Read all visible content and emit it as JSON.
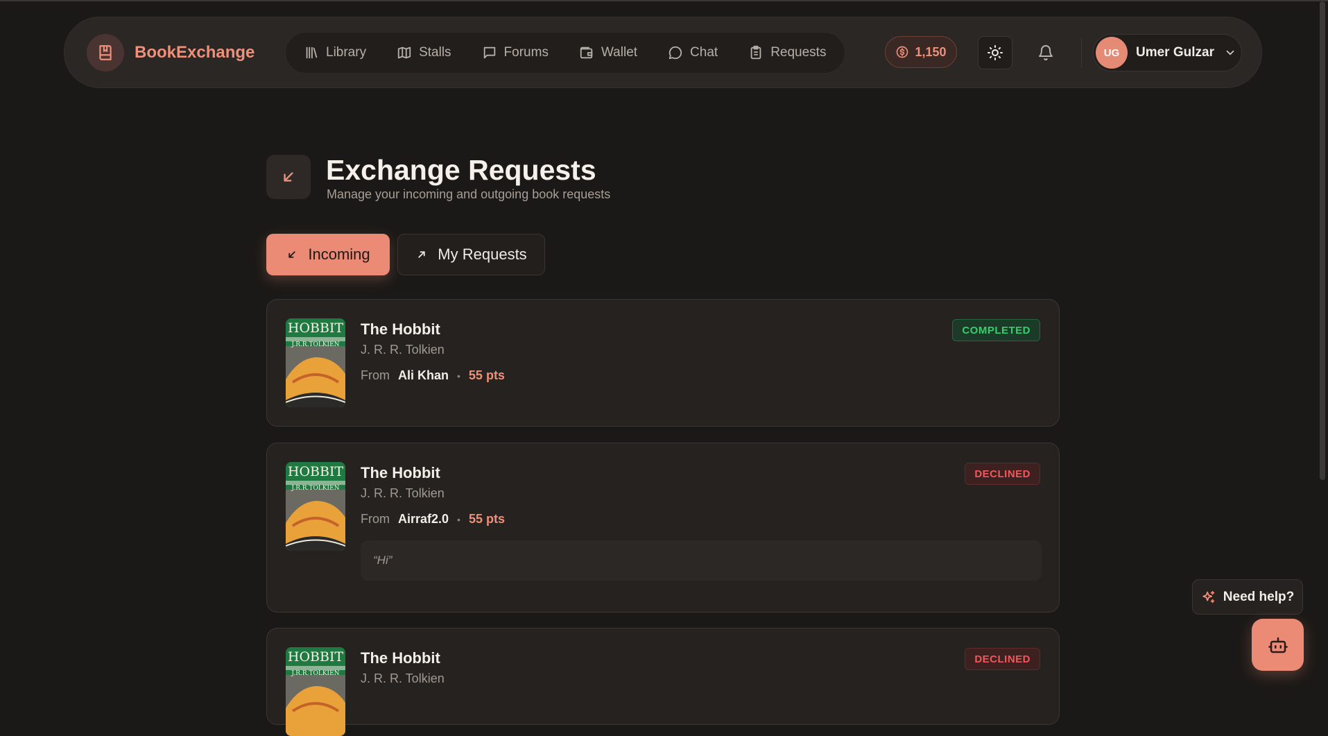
{
  "app": {
    "name": "BookExchange"
  },
  "nav": {
    "items": [
      {
        "label": "Library",
        "icon": "library-icon"
      },
      {
        "label": "Stalls",
        "icon": "map-icon"
      },
      {
        "label": "Forums",
        "icon": "message-square-icon"
      },
      {
        "label": "Wallet",
        "icon": "wallet-icon"
      },
      {
        "label": "Chat",
        "icon": "chat-bubble-icon"
      },
      {
        "label": "Requests",
        "icon": "clipboard-icon"
      }
    ],
    "points": "1,150",
    "user": {
      "initials": "UG",
      "name": "Umer Gulzar"
    }
  },
  "header": {
    "title": "Exchange Requests",
    "subtitle": "Manage your incoming and outgoing book requests"
  },
  "tabs": [
    {
      "label": "Incoming",
      "active": true
    },
    {
      "label": "My Requests",
      "active": false
    }
  ],
  "requests": [
    {
      "title": "The Hobbit",
      "author": "J. R. R. Tolkien",
      "from_label": "From",
      "from": "Ali Khan",
      "points": "55 pts",
      "status": "COMPLETED",
      "note": ""
    },
    {
      "title": "The Hobbit",
      "author": "J. R. R. Tolkien",
      "from_label": "From",
      "from": "Airraf2.0",
      "points": "55 pts",
      "status": "DECLINED",
      "note": "“Hi”"
    },
    {
      "title": "The Hobbit",
      "author": "J. R. R. Tolkien",
      "from_label": "From",
      "from": "",
      "points": "",
      "status": "DECLINED",
      "note": ""
    }
  ],
  "cover_text": {
    "line1": "HOBBIT",
    "line2": "J.R.R.TOLKIEN"
  },
  "help": {
    "label": "Need help?"
  },
  "colors": {
    "accent": "#eb8b75",
    "background": "#1b1917",
    "completed": "#34d06c",
    "declined": "#f1585a"
  }
}
